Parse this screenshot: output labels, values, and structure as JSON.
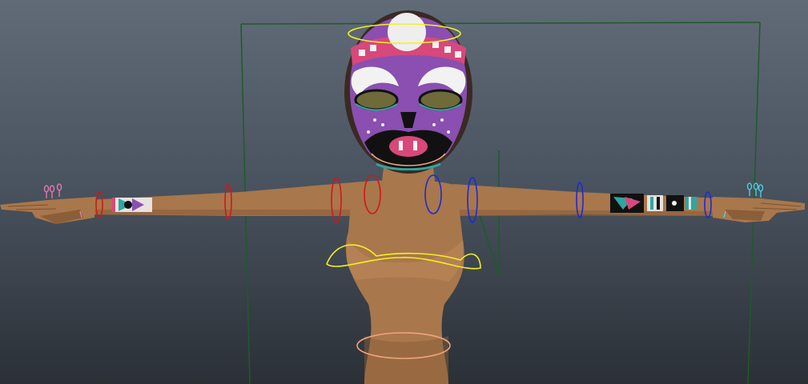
{
  "viewport": {
    "label": "",
    "background_top": "#606b77",
    "background_bottom": "#2b3037"
  },
  "scene": {
    "object": "t-pose-character-with-tribal-mask",
    "colors": {
      "skin": "#a9774c",
      "skin_shadow": "#8a5e38",
      "mask_purple": "#8a4fb0",
      "mask_black": "#111111",
      "mask_white": "#f2f2f2",
      "mask_pink": "#d8487a",
      "mask_teal": "#2fa6a0",
      "eyelid_olive": "#6e6a3a",
      "bounding_box_green": "#1f5a2a",
      "ctrl_red": "#d01818",
      "ctrl_blue": "#1a2ad8",
      "ctrl_yellow": "#f2f020",
      "ctrl_salmon": "#f0a27a",
      "ctrl_pink_fingers": "#f07ab8",
      "ctrl_cyan_fingers": "#48d8f0"
    },
    "controls": [
      "left-wrist-control",
      "left-elbow-control",
      "left-shoulder-control",
      "left-clavicle-control",
      "neck-control",
      "right-clavicle-control",
      "right-shoulder-control",
      "right-elbow-control",
      "right-wrist-control",
      "chest-control",
      "hip-control",
      "head-control",
      "left-finger-controls",
      "right-finger-controls"
    ]
  }
}
